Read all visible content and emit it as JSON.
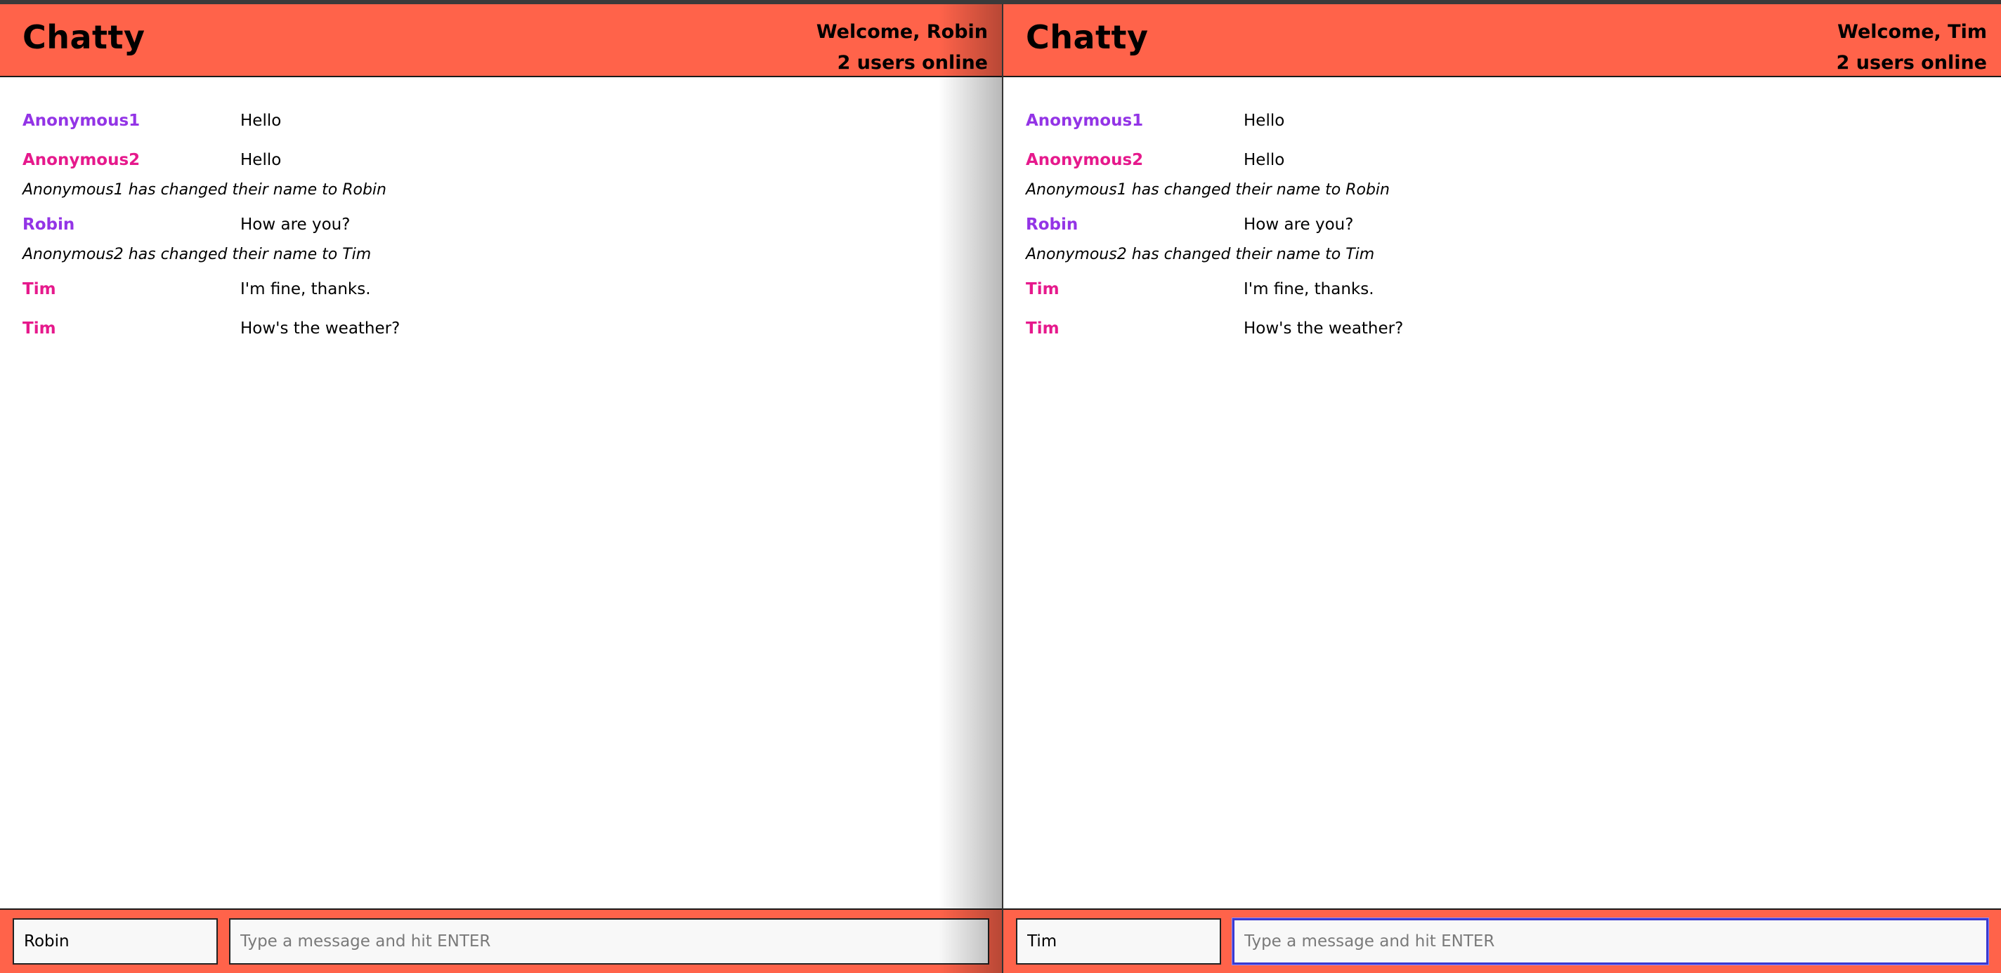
{
  "colors": {
    "accent": "#FF634A",
    "user_purple": "#9334E6",
    "user_pink": "#E6198C"
  },
  "windows": [
    {
      "brand": "Chatty",
      "welcome": "Welcome, Robin",
      "online": "2 users online",
      "name_value": "Robin",
      "message_placeholder": "Type a message and hit ENTER",
      "message_value": ""
    },
    {
      "brand": "Chatty",
      "welcome": "Welcome, Tim",
      "online": "2 users online",
      "name_value": "Tim",
      "message_placeholder": "Type a message and hit ENTER",
      "message_value": ""
    }
  ],
  "messages": [
    {
      "type": "message",
      "user": "Anonymous1",
      "color": "#9334E6",
      "content": "Hello"
    },
    {
      "type": "message",
      "user": "Anonymous2",
      "color": "#E6198C",
      "content": "Hello"
    },
    {
      "type": "notice",
      "content": "Anonymous1 has changed their name to Robin"
    },
    {
      "type": "message",
      "user": "Robin",
      "color": "#9334E6",
      "content": "How are you?"
    },
    {
      "type": "notice",
      "content": "Anonymous2 has changed their name to Tim"
    },
    {
      "type": "message",
      "user": "Tim",
      "color": "#E6198C",
      "content": "I'm fine, thanks."
    },
    {
      "type": "message",
      "user": "Tim",
      "color": "#E6198C",
      "content": "How's the weather?"
    }
  ]
}
